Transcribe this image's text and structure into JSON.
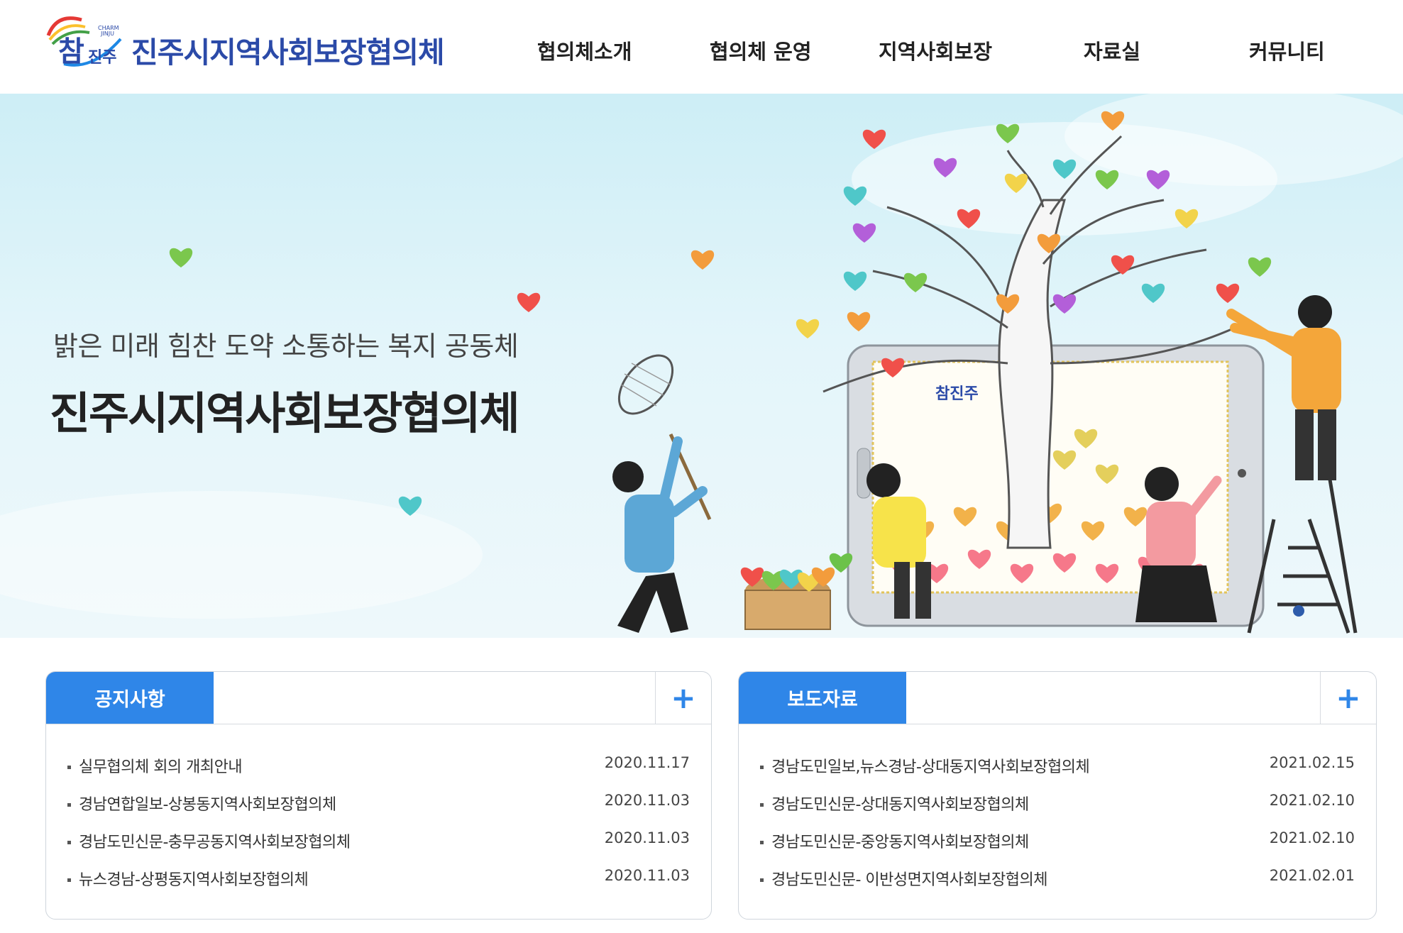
{
  "header": {
    "logo_alt": "참진주 CHARM JINJU",
    "title": "진주시지역사회보장협의체",
    "nav": [
      {
        "label": "협의체소개"
      },
      {
        "label": "협의체 운영"
      },
      {
        "label": "지역사회보장"
      },
      {
        "label": "자료실"
      },
      {
        "label": "커뮤니티"
      }
    ]
  },
  "banner": {
    "slogan": "밝은 미래 힘찬 도약 소통하는 복지 공동체",
    "title": "진주시지역사회보장협의체"
  },
  "boards": [
    {
      "tab": "공지사항",
      "more": "+",
      "items": [
        {
          "title": "실무협의체 회의 개최안내",
          "date": "2020.11.17"
        },
        {
          "title": "경남연합일보-상봉동지역사회보장협의체",
          "date": "2020.11.03"
        },
        {
          "title": "경남도민신문-충무공동지역사회보장협의체",
          "date": "2020.11.03"
        },
        {
          "title": "뉴스경남-상평동지역사회보장협의체",
          "date": "2020.11.03"
        }
      ]
    },
    {
      "tab": "보도자료",
      "more": "+",
      "items": [
        {
          "title": "경남도민일보,뉴스경남-상대동지역사회보장협의체",
          "date": "2021.02.15"
        },
        {
          "title": "경남도민신문-상대동지역사회보장협의체",
          "date": "2021.02.10"
        },
        {
          "title": "경남도민신문-중앙동지역사회보장협의체",
          "date": "2021.02.10"
        },
        {
          "title": "경남도민신문- 이반성면지역사회보장협의체",
          "date": "2021.02.01"
        }
      ]
    }
  ],
  "colors": {
    "brand": "#2b4aa8",
    "tab": "#2f86e8",
    "indicator": "#2e5cab"
  }
}
